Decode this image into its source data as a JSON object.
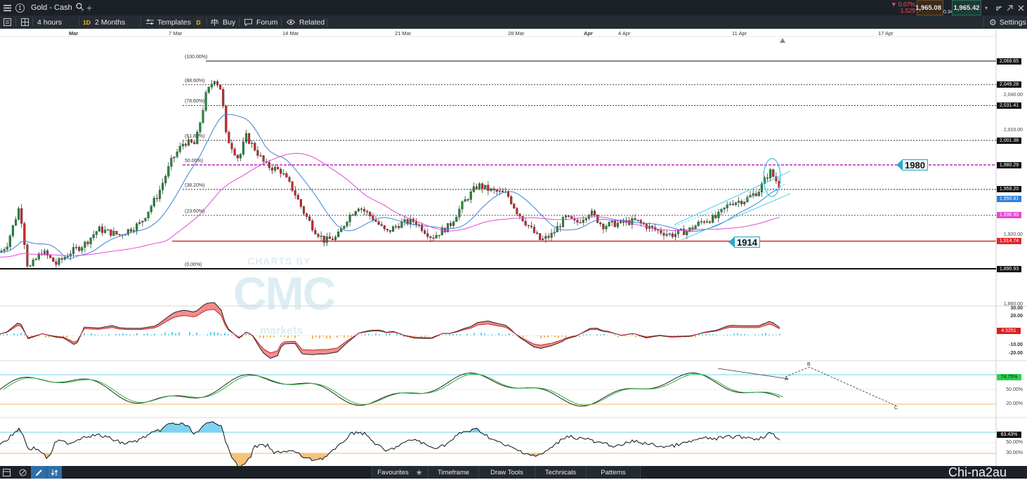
{
  "header": {
    "menu_icon": "hamburger-menu-icon",
    "instrument_number": "1",
    "instrument": "Gold - Cash",
    "search_icon": "search-icon",
    "add_icon": "plus-icon",
    "change_pct": "▼ 0.07%",
    "change_abs": "1.525",
    "sell_price": "1,965.08",
    "spread": "0.34",
    "buy_price": "1,965.42",
    "window_icons": [
      "dropdown-icon",
      "minimize-icon",
      "maximize-icon",
      "close-icon"
    ]
  },
  "toolbar": {
    "interval": "4 hours",
    "period_code": "1D",
    "period": "2 Months",
    "templates": "Templates",
    "draw_code": "D",
    "buy": "Buy",
    "forum": "Forum",
    "related": "Related",
    "settings": "Settings"
  },
  "date_axis": [
    "Mar",
    "7 Mar",
    "14 Mar",
    "21 Mar",
    "28 Mar",
    "Apr",
    "4 Apr",
    "11 Apr",
    "17 Apr"
  ],
  "price_axis": {
    "ticks": [
      "2,040.00",
      "2,010.00",
      "1,920.00",
      "1,860.00"
    ],
    "boxes": [
      "2,069.65",
      "2,049.28",
      "2,031.41",
      "2,001.38",
      "1,980.29",
      "1,959.20",
      "1,950.81",
      "1,936.90",
      "1,914.74",
      "1,890.93"
    ]
  },
  "fibonacci": [
    "(100.00%)",
    "(88.60%)",
    "(78.60%)",
    "(61.80%)",
    "50.00%)",
    "(38.20%)",
    "(23.60%)",
    "(0.00%)"
  ],
  "levels": {
    "upper": "1980",
    "lower": "1914"
  },
  "watermark": {
    "line1": "CHARTS BY",
    "logo": "CMC",
    "line3": "markets"
  },
  "macd_axis": [
    "30.00",
    "20.00",
    "-10.00",
    "-20.00"
  ],
  "macd_value": "4.5251",
  "stoch": {
    "axis": [
      "50.00%",
      "20.00%"
    ],
    "value": "74.75%",
    "labels": [
      "A",
      "B",
      "C"
    ]
  },
  "rsi": {
    "axis": [
      "50.00%",
      "30.00%"
    ],
    "value": "63.43%"
  },
  "colors": {
    "fib_top": "#000000",
    "resistance": "#c026c0",
    "support": "#e3262b",
    "bull": "#1c8a3a",
    "bear": "#c7272c",
    "ma_fast": "#3a84d6",
    "ma_slow": "#e349d4",
    "channel": "#3cc3e0"
  },
  "footer": {
    "items": [
      "Favourites",
      "Timeframe",
      "Draw Tools",
      "Technicals",
      "Patterns"
    ],
    "icons": [
      "layout-icon",
      "hide-icon",
      "pencil-icon",
      "arrows-icon",
      "star-icon"
    ]
  },
  "watermark_corner": "Chi-na2au"
}
